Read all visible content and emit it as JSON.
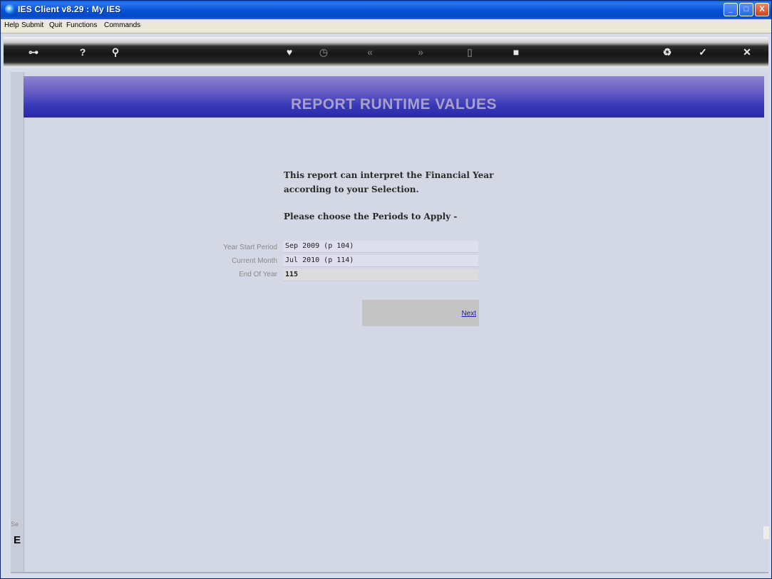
{
  "window": {
    "title": "IES Client v8.29 : My IES",
    "controls": {
      "minimize": "_",
      "maximize": "□",
      "close": "X"
    }
  },
  "menu": {
    "items": [
      "Help",
      "Submit",
      "Quit",
      "Functions",
      "Commands"
    ]
  },
  "toolbar": {
    "icons": [
      {
        "name": "key-icon",
        "glyph": "⊶",
        "enabled": true
      },
      {
        "name": "help-icon",
        "glyph": "?",
        "enabled": true
      },
      {
        "name": "search-icon",
        "glyph": "⚲",
        "enabled": true
      },
      {
        "name": "heart-icon",
        "glyph": "♥",
        "enabled": true
      },
      {
        "name": "clock-icon",
        "glyph": "◷",
        "enabled": false
      },
      {
        "name": "rewind-icon",
        "glyph": "«",
        "enabled": false
      },
      {
        "name": "forward-icon",
        "glyph": "»",
        "enabled": false
      },
      {
        "name": "column-icon",
        "glyph": "▯",
        "enabled": false
      },
      {
        "name": "stop-icon",
        "glyph": "■",
        "enabled": true
      },
      {
        "name": "recycle-icon",
        "glyph": "♻",
        "enabled": true
      },
      {
        "name": "check-icon",
        "glyph": "✓",
        "enabled": true
      },
      {
        "name": "close-icon",
        "glyph": "✕",
        "enabled": true
      }
    ]
  },
  "page": {
    "heading": "REPORT RUNTIME VALUES",
    "intro_line1": "This report can interpret the Financial Year",
    "intro_line2": "according to your Selection.",
    "intro_line3": "Please choose the Periods to Apply -"
  },
  "form": {
    "year_start_label": "Year Start Period",
    "year_start_value": "Sep 2009 (p 104)",
    "current_month_label": "Current Month",
    "current_month_value": "Jul 2010 (p 114)",
    "end_of_year_label": "End Of Year",
    "end_of_year_value": "115"
  },
  "actions": {
    "next_label": "Next"
  },
  "sidebar": {
    "label": "Se",
    "glyph": "E"
  }
}
